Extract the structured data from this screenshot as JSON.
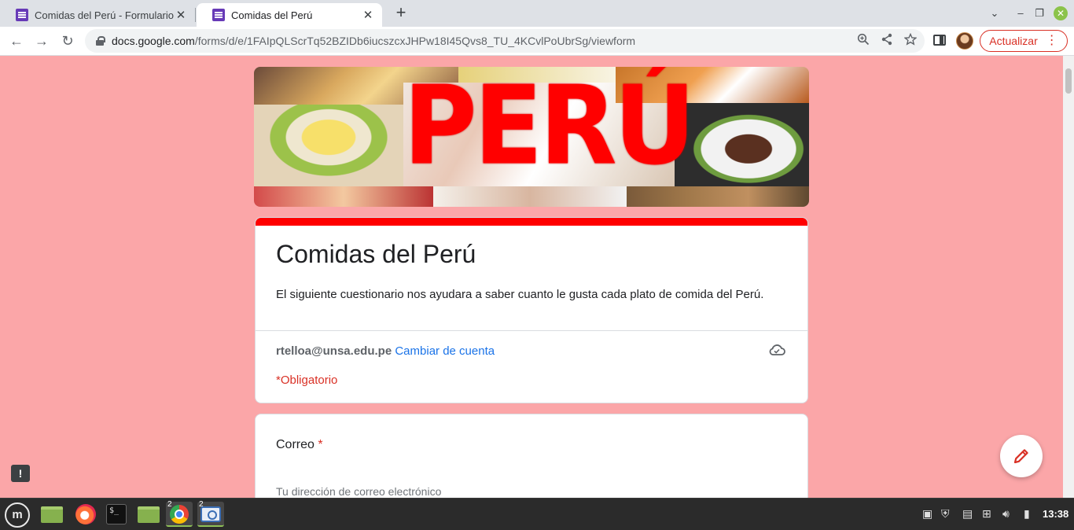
{
  "browser": {
    "tabs": [
      {
        "title": "Comidas del Perú - Formulario",
        "active": false
      },
      {
        "title": "Comidas del Perú",
        "active": true
      }
    ],
    "new_tab_label": "+",
    "address": {
      "host": "docs.google.com",
      "path": "/forms/d/e/1FAIpQLScrTq52BZIDb6iucszcxJHPw18I45Qvs8_TU_4KCvlPoUbrSg/viewform"
    },
    "update_button": "Actualizar",
    "icons": [
      "back-icon",
      "forward-icon",
      "reload-icon",
      "lock-icon",
      "zoom-icon",
      "share-icon",
      "star-icon",
      "side-panel-icon",
      "profile-avatar"
    ]
  },
  "form": {
    "banner_word": "PERÚ",
    "title": "Comidas del Perú",
    "description": "El siguiente cuestionario nos ayudara a saber cuanto le gusta cada plato de comida del Perú.",
    "account_email": "rtelloa@unsa.edu.pe",
    "switch_account": "Cambiar de cuenta",
    "required_note": "*Obligatorio",
    "questions": [
      {
        "label": "Correo",
        "required_mark": "*",
        "placeholder": "Tu dirección de correo electrónico"
      }
    ],
    "accent_color": "#ff0000",
    "background_color": "#fba6a8"
  },
  "taskbar": {
    "badges": {
      "chrome": "2",
      "camera": "2"
    },
    "clock": "13:38"
  }
}
